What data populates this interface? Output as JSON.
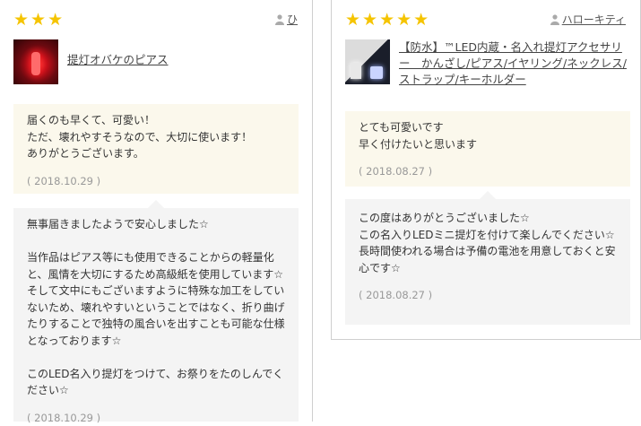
{
  "colors": {
    "star": "#f5c400",
    "review_bg": "#fbf8ec",
    "reply_bg": "#f4f4f4",
    "date": "#999999"
  },
  "reviews": [
    {
      "stars": "★★★",
      "rating": 3,
      "reviewer": "ひ",
      "user_icon": "user-icon",
      "product": "提灯オバケのピアス",
      "comment": "届くのも早くて、可愛い！\nただ、壊れやすそうなので、大切に使います！\nありがとうございます。",
      "comment_date": "( 2018.10.29 )",
      "reply": "無事届きましたようで安心しました☆\n\n当作品はピアス等にも使用できることからの軽量化と、風情を大切にするため高級紙を使用しています☆ そして文中にもございますように特殊な加工をしていないため、壊れやすいということではなく、折り曲げたりすることで独特の風合いを出すことも可能な仕様となっております☆\n\nこのLED名入り提灯をつけて、お祭りをたのしんでください☆",
      "reply_date": "( 2018.10.29 )"
    },
    {
      "stars": "★★★★★",
      "rating": 5,
      "reviewer": "ハローキティ",
      "user_icon": "user-icon",
      "product": "【防水】™LED内蔵・名入れ提灯アクセサリー　かんざし/ピアス/イヤリング/ネックレス/ストラップ/キーホルダー",
      "comment": "とても可愛いです\n早く付けたいと思います",
      "comment_date": "( 2018.08.27 )",
      "reply": "この度はありがとうございました☆\nこの名入りLEDミニ提灯を付けて楽しんでください☆\n長時間使われる場合は予備の電池を用意しておくと安心です☆",
      "reply_date": "( 2018.08.27 )"
    }
  ]
}
